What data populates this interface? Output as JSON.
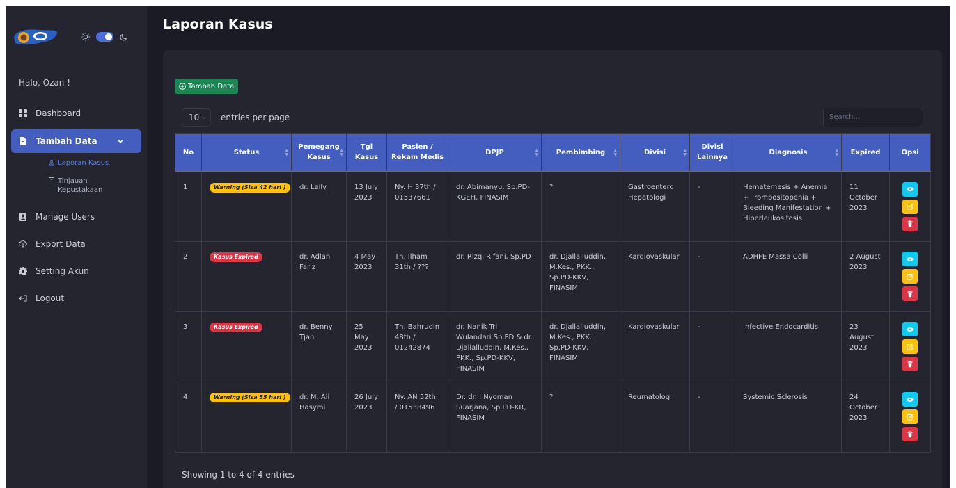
{
  "sidebar": {
    "greeting": "Halo, Ozan !",
    "items": [
      {
        "label": "Dashboard"
      },
      {
        "label": "Tambah Data"
      },
      {
        "label": "Manage Users"
      },
      {
        "label": "Export Data"
      },
      {
        "label": "Setting Akun"
      },
      {
        "label": "Logout"
      }
    ],
    "submenu": [
      {
        "label": "Laporan Kasus"
      },
      {
        "label": "Tinjauan Kepustakaan"
      }
    ]
  },
  "page": {
    "title": "Laporan Kasus",
    "add_button": "Tambah Data",
    "entries_value": "10",
    "entries_label": "entries per page",
    "search_placeholder": "Search...",
    "footer": "Showing 1 to 4 of 4 entries"
  },
  "table": {
    "headers": [
      "No",
      "Status",
      "Pemegang Kasus",
      "Tgl Kasus",
      "Pasien / Rekam Medis",
      "DPJP",
      "Pembimbing",
      "Divisi",
      "Divisi Lainnya",
      "Diagnosis",
      "Expired",
      "Opsi"
    ],
    "rows": [
      {
        "no": "1",
        "status": "Warning (Sisa 42 hari )",
        "status_type": "warning",
        "pemegang": "dr. Laily",
        "tgl": "13 July 2023",
        "pasien": "Ny. H 37th / 01537661",
        "dpjp": "dr. Abimanyu, Sp.PD-KGEH, FINASIM",
        "pembimbing": "?",
        "divisi": "Gastroentero Hepatologi",
        "divisi_lain": "-",
        "diagnosis": "Hematemesis + Anemia + Trombositopenia + Bleeding Manifestation + Hiperleukositosis",
        "expired": "11 October 2023"
      },
      {
        "no": "2",
        "status": "Kasus Expired",
        "status_type": "expired",
        "pemegang": "dr. Adlan Fariz",
        "tgl": "4 May 2023",
        "pasien": "Tn. Ilham 31th / ???",
        "dpjp": "dr. Rizqi Rifani, Sp.PD",
        "pembimbing": "dr. Djallalluddin, M.Kes., PKK., Sp.PD-KKV, FINASIM",
        "divisi": "Kardiovaskular",
        "divisi_lain": "-",
        "diagnosis": "ADHFE Massa Colli",
        "expired": "2 August 2023"
      },
      {
        "no": "3",
        "status": "Kasus Expired",
        "status_type": "expired",
        "pemegang": "dr. Benny Tjan",
        "tgl": "25 May 2023",
        "pasien": "Tn. Bahrudin 48th / 01242874",
        "dpjp": "dr. Nanik Tri Wulandari Sp.PD & dr. Djallalluddin, M.Kes., PKK., Sp.PD-KKV, FINASIM",
        "pembimbing": "dr. Djallalluddin, M.Kes., PKK., Sp.PD-KKV, FINASIM",
        "divisi": "Kardiovaskular",
        "divisi_lain": "-",
        "diagnosis": "Infective Endocarditis",
        "expired": "23 August 2023"
      },
      {
        "no": "4",
        "status": "Warning (Sisa 55 hari )",
        "status_type": "warning",
        "pemegang": "dr. M. Ali Hasymi",
        "tgl": "26 July 2023",
        "pasien": "Ny. AN 52th / 01538496",
        "dpjp": "Dr. dr. I Nyoman Suarjana, Sp.PD-KR, FINASIM",
        "pembimbing": "?",
        "divisi": "Reumatologi",
        "divisi_lain": "-",
        "diagnosis": "Systemic Sclerosis",
        "expired": "24 October 2023"
      }
    ]
  },
  "colors": {
    "primary": "#435ebe",
    "success": "#198754",
    "warning": "#ffc107",
    "danger": "#dc3545",
    "info": "#0dcaf0"
  }
}
